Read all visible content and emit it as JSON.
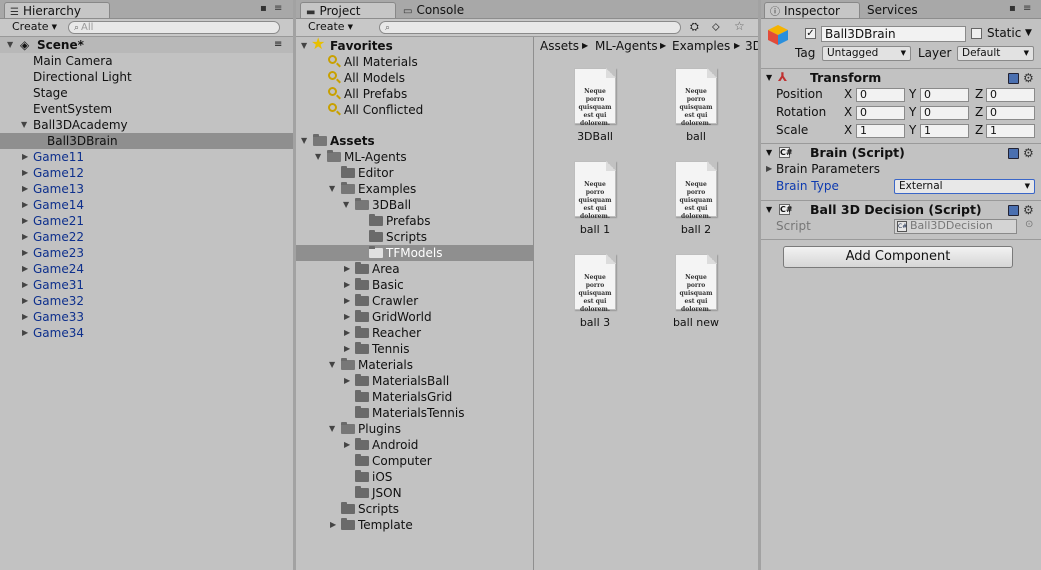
{
  "hierarchy": {
    "tab": "Hierarchy",
    "create": "Create",
    "search_placeholder": "All",
    "scene": "Scene*",
    "items": [
      "Main Camera",
      "Directional Light",
      "Stage",
      "EventSystem",
      "Ball3DAcademy",
      "Ball3DBrain"
    ],
    "games": [
      "Game11",
      "Game12",
      "Game13",
      "Game14",
      "Game21",
      "Game22",
      "Game23",
      "Game24",
      "Game31",
      "Game32",
      "Game33",
      "Game34"
    ]
  },
  "project": {
    "tab_project": "Project",
    "tab_console": "Console",
    "create": "Create",
    "favorites": {
      "title": "Favorites",
      "items": [
        "All Materials",
        "All Models",
        "All Prefabs",
        "All Conflicted"
      ]
    },
    "tree": {
      "assets": "Assets",
      "ml_agents": "ML-Agents",
      "editor": "Editor",
      "examples": "Examples",
      "ball3d": "3DBall",
      "prefabs": "Prefabs",
      "scripts": "Scripts",
      "tfmodels": "TFModels",
      "area": "Area",
      "basic": "Basic",
      "crawler": "Crawler",
      "gridworld": "GridWorld",
      "reacher": "Reacher",
      "tennis": "Tennis",
      "materials": "Materials",
      "materials_ball": "MaterialsBall",
      "materials_grid": "MaterialsGrid",
      "materials_tennis": "MaterialsTennis",
      "plugins": "Plugins",
      "android": "Android",
      "computer": "Computer",
      "ios": "iOS",
      "json": "JSON",
      "scripts2": "Scripts",
      "template": "Template"
    },
    "breadcrumb": [
      "Assets",
      "ML-Agents",
      "Examples",
      "3D"
    ],
    "doc_preview": "Neque porro quisquam est qui dolorem.",
    "assets": [
      "3DBall",
      "ball",
      "ball 1",
      "ball 2",
      "ball 3",
      "ball new"
    ]
  },
  "inspector": {
    "tab_inspector": "Inspector",
    "tab_services": "Services",
    "object_name": "Ball3DBrain",
    "static_label": "Static",
    "tag_label": "Tag",
    "tag_value": "Untagged",
    "layer_label": "Layer",
    "layer_value": "Default",
    "transform": {
      "title": "Transform",
      "position_label": "Position",
      "rotation_label": "Rotation",
      "scale_label": "Scale",
      "x": "X",
      "y": "Y",
      "z": "Z",
      "position": [
        "0",
        "0",
        "0"
      ],
      "rotation": [
        "0",
        "0",
        "0"
      ],
      "scale": [
        "1",
        "1",
        "1"
      ]
    },
    "brain": {
      "title": "Brain (Script)",
      "params": "Brain Parameters",
      "type_label": "Brain Type",
      "type_value": "External"
    },
    "decision": {
      "title": "Ball 3D Decision (Script)",
      "script_label": "Script",
      "script_value": "Ball3DDecision"
    },
    "add_component": "Add Component"
  }
}
